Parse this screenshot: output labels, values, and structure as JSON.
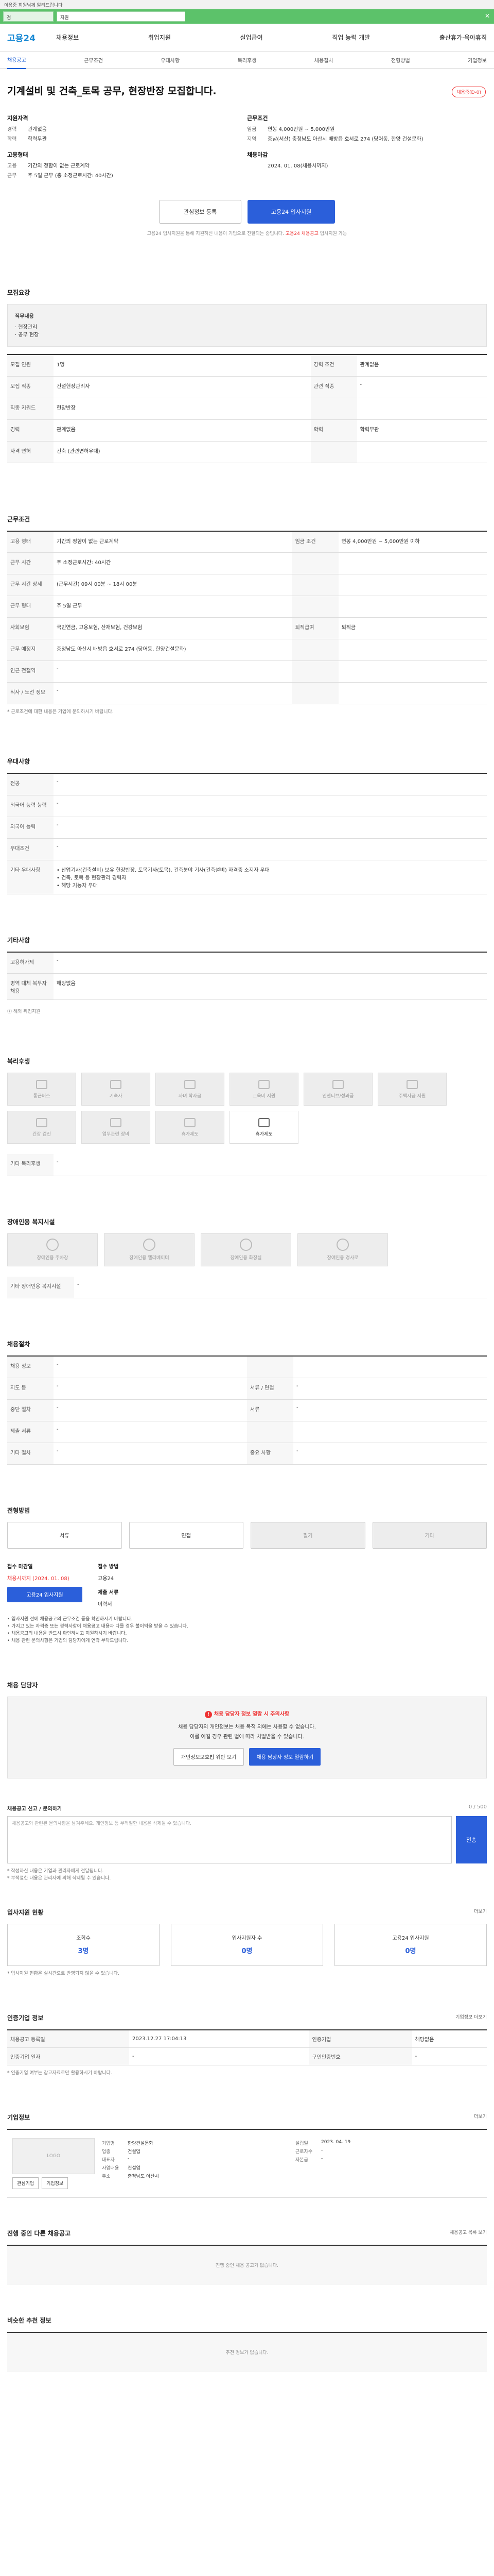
{
  "topnotice": "이용중 회원님께 알려드립니다",
  "greenbar": {
    "box1": "검",
    "box2": "지원"
  },
  "gnb": {
    "logo_pre": "고용",
    "logo_post": "24",
    "menu": [
      "채용정보",
      "취업지원",
      "실업급여",
      "직업 능력 개발",
      "출산휴가·육아휴직"
    ]
  },
  "tabs": [
    "채용공고",
    "근무조건",
    "우대사항",
    "복리후생",
    "채용절차",
    "전형방법",
    "기업정보"
  ],
  "summary": {
    "badge": "채용중(D-0)",
    "title": "기계설비 및 건축_토목 공무, 현장반장 모집합니다.",
    "left_h": "지원자격",
    "left_kv": [
      {
        "k": "경력",
        "v": "관계없음"
      },
      {
        "k": "학력",
        "v": "학력무관"
      }
    ],
    "left2_h": "고용형태",
    "left2_kv": [
      {
        "k": "고용",
        "v": "기간의 정함이 없는 근로계약"
      },
      {
        "k": "근무",
        "v": "주 5일 근무 (총 소정근로시간: 40시간)"
      }
    ],
    "right_h": "근무조건",
    "right_kv": [
      {
        "k": "임금",
        "v": "연봉 4,000만원 ~ 5,000만원"
      },
      {
        "k": "지역",
        "v": "충남(서산) 충청남도 아산시 배방읍 호서로 274 (당어동, 한양 건설문화)"
      }
    ],
    "right2_h": "채용마감",
    "right2_kv": [
      {
        "k": "",
        "v": "2024. 01. 08(채용시까지)"
      }
    ],
    "btn_save": "관심정보 등록",
    "btn_apply": "고용24 입사지원",
    "note_pre": "고용24 입사지원을 통해 지원하신 내용이 기업으로 전달되는 중입니다.",
    "note_red": "고용24 채용공고",
    "note_post": "입사지원 가능"
  },
  "recruit": {
    "title": "모집요강",
    "job_h": "직무내용",
    "jobs": [
      "· 현장관리",
      "· 공무 현장"
    ],
    "rows": [
      [
        "모집 인원",
        "1명",
        "경력 조건",
        "관계없음"
      ],
      [
        "모집 직종",
        "건설현장관리자",
        "관련 직종",
        "-"
      ],
      [
        "직종 키워드",
        "현장반장",
        "",
        ""
      ],
      [
        "경력",
        "관계없음",
        "학력",
        "학력무관"
      ],
      [
        "자격 면허",
        "건축 (관련면허우대)",
        "",
        ""
      ]
    ]
  },
  "cond": {
    "title": "근무조건",
    "rows": [
      [
        "고용 형태",
        "기간의 정함이 없는 근로계약",
        "임금 조건",
        "연봉 4,000만원 ~ 5,000만원 이하"
      ],
      [
        "근무 시간",
        "주 소정근로시간: 40시간",
        "",
        ""
      ],
      [
        "근무 시간 상세",
        "(근무시간) 09시 00분 ~ 18시 00분",
        "",
        ""
      ],
      [
        "근무 형태",
        "주 5일 근무",
        "",
        ""
      ],
      [
        "사회보험",
        "국민연금, 고용보험, 산재보험, 건강보험",
        "퇴직급여",
        "퇴직금"
      ],
      [
        "근무 예정지",
        "충청남도 아산시 배방읍 호서로 274 (당어동, 한양건설문화)",
        "",
        ""
      ],
      [
        "인근 전철역",
        "-",
        "",
        ""
      ],
      [
        "식사 / 노선 정보",
        "-",
        "",
        ""
      ]
    ],
    "note": "* 근로조건에 대한 내용은 기업에 문의하시기 바랍니다."
  },
  "pref": {
    "title": "우대사항",
    "rows": [
      [
        "전공",
        "-"
      ],
      [
        "외국어 능력 능력",
        "-"
      ],
      [
        "외국어 능력",
        "-"
      ],
      [
        "우대조건",
        "-"
      ],
      [
        "기타 우대사항",
        "• 산업기사(건축설비) 보유 현장반장, 토목기사(토목), 건축분야 기사(건축설비) 자격증 소지자 우대\n• 건축, 토목 등 현장관리 경력자\n• 해당 기능자 우대"
      ]
    ]
  },
  "etc": {
    "title": "기타사항",
    "rows": [
      [
        "고용허가제",
        "-"
      ],
      [
        "병역 대체 복무자 채용",
        "해당없음"
      ]
    ],
    "link": "해외 취업지원"
  },
  "welfare": {
    "title": "복리후생",
    "items": [
      "통근버스",
      "기숙사",
      "자녀 학자금",
      "교육비 지원",
      "인센티브/성과급",
      "주택자금 지원",
      "건강 검진",
      "업무관련 장비",
      "휴가제도",
      "휴가제도"
    ],
    "note_h": "기타 복리후생",
    "note": "-"
  },
  "disabled": {
    "title": "장애인용 복지시설",
    "items": [
      "장애인용 주차장",
      "장애인용 엘리베이터",
      "장애인용 화장실",
      "장애인용 경사로"
    ],
    "note_h": "기타 장애인용 복지시설",
    "note": "-"
  },
  "procedure": {
    "title": "채용절차",
    "rows": [
      [
        "채용 정보",
        "-",
        "",
        ""
      ],
      [
        "지도 등",
        "-",
        "서류 / 면접",
        "-"
      ],
      [
        "중단 절차",
        "-",
        "서류",
        "-"
      ],
      [
        "제출 서류",
        "-",
        "",
        ""
      ],
      [
        "기타 절차",
        "-",
        "중요 사항",
        "-"
      ]
    ]
  },
  "method": {
    "title": "전형방법",
    "steps": [
      "서류",
      "면접",
      "필기",
      "기타"
    ],
    "apply_h": "접수 마감일",
    "apply_v": "채용시까지",
    "apply_v2": "2024. 01. 08",
    "apply_btn": "고용24 입사지원",
    "method_h": "접수 방법",
    "method_v": "고용24",
    "submit_h": "제출 서류",
    "submit_v": "이력서",
    "bullets": [
      "입사지원 전에 채용공고의 근무조건 등을 확인하시기 바랍니다.",
      "가지고 있는 자격증 또는 경력사항이 채용공고 내용과 다를 경우 불이익을 받을 수 있습니다.",
      "채용공고의 내용을 반드시 확인하시고 지원하시기 바랍니다.",
      "채용 관련 문의사항은 기업의 담당자에게 연락 부탁드립니다."
    ]
  },
  "contact": {
    "title": "채용 담당자",
    "warn_title": "채용 담당자 정보 열람 시 주의사항",
    "warn_text": "채용 담당자의 개인정보는 채용 목적 외에는 사용할 수 없습니다.",
    "warn_text2": "이를 어길 경우 관련 법에 따라 처벌받을 수 있습니다.",
    "btn1": "개인정보보호법 위반 보기",
    "btn2": "채용 담당자 정보 열람하기"
  },
  "comment": {
    "title": "채용공고 신고 / 문의하기",
    "count": "0 / 500",
    "placeholder": "채용공고와 관련된 문의사항을 남겨주세요. 개인정보 등 부적절한 내용은 삭제될 수 있습니다.",
    "btn": "전송",
    "notes": [
      "* 작성하신 내용은 기업과 관리자에게 전달됩니다.",
      "* 부적절한 내용은 관리자에 의해 삭제될 수 있습니다."
    ]
  },
  "stats": {
    "title": "입사지원 현황",
    "more": "더보기",
    "items": [
      {
        "label": "조회수",
        "v": "3명"
      },
      {
        "label": "입사지원자 수",
        "v": "0명"
      },
      {
        "label": "고용24 입사지원",
        "v": "0명"
      }
    ],
    "note": "* 입사지원 현황은 실시간으로 반영되지 않을 수 있습니다."
  },
  "certinfo": {
    "title": "인증기업 정보",
    "more": "기업정보 더보기",
    "rows": [
      [
        "채용공고 등록일",
        "2023.12.27 17:04:13",
        "인증기업",
        "해당없음"
      ],
      [
        "인증기업 일자",
        "-",
        "구인인증번호",
        "-"
      ]
    ],
    "note": "* 인증기업 여부는 참고자료로만 활용하시기 바랍니다."
  },
  "company": {
    "title": "기업정보",
    "more": "더보기",
    "logo": "LOGO",
    "kv": [
      {
        "k": "기업명",
        "v": "한양건설문화"
      },
      {
        "k": "업종",
        "v": "건설업"
      },
      {
        "k": "대표자",
        "v": "-"
      },
      {
        "k": "사업내용",
        "v": "건설업"
      },
      {
        "k": "주소",
        "v": "충청남도 아산시"
      }
    ],
    "kv2": [
      {
        "k": "설립일",
        "v": "2023. 04. 19"
      },
      {
        "k": "근로자수",
        "v": "-"
      },
      {
        "k": "자본금",
        "v": "-"
      }
    ],
    "btn1": "관심기업",
    "btn2": "기업정보"
  },
  "ongoing": {
    "title": "진행 중인 다른 채용공고",
    "more": "채용공고 목록 보기",
    "empty": "진행 중인 채용 공고가 없습니다."
  },
  "recommend": {
    "title": "비슷한 추천 정보",
    "empty": "추천 정보가 없습니다."
  }
}
